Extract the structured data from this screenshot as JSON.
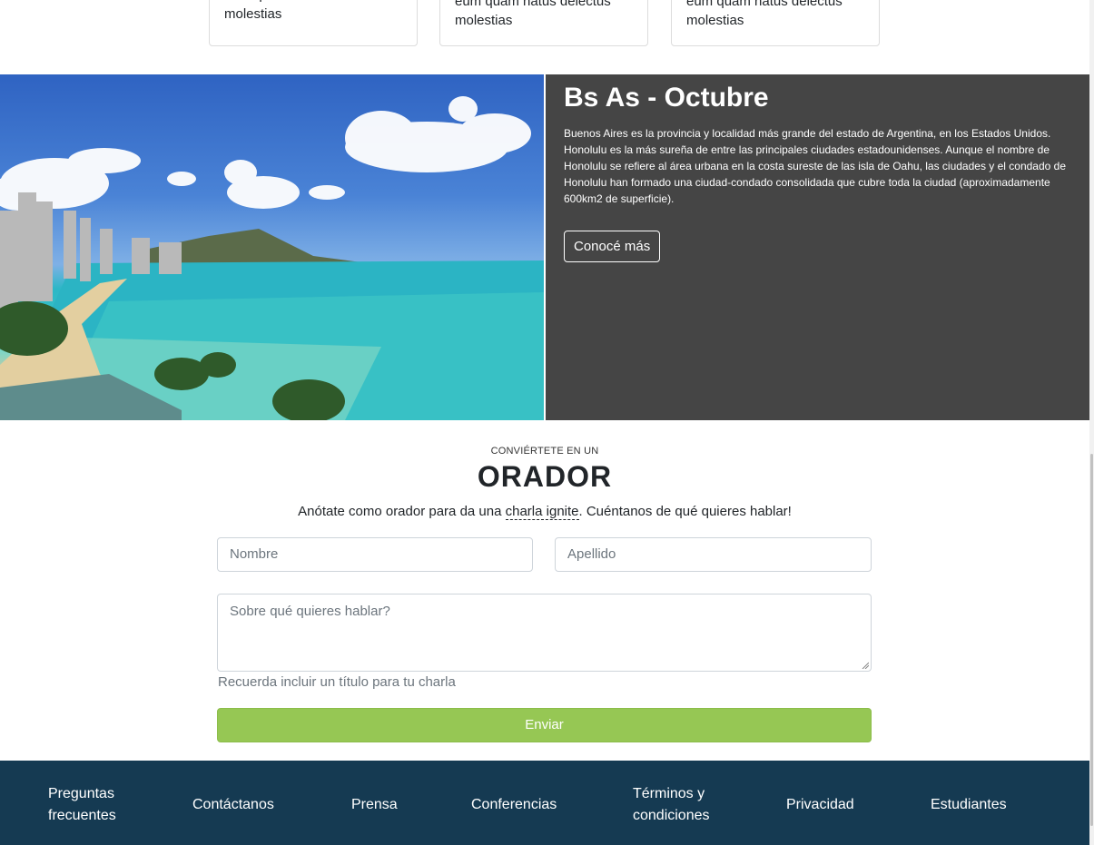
{
  "cards": [
    {
      "text": "eum quam natus delectus molestias"
    },
    {
      "text": "eum quam natus delectus molestias"
    },
    {
      "text": "eum quam natus delectus molestias"
    }
  ],
  "hero": {
    "title": "Bs As - Octubre",
    "description": "Buenos Aires es la provincia y localidad más grande del estado de Argentina, en los Estados Unidos. Honolulu es la más sureña de entre las principales ciudades estadounidenses. Aunque el nombre de Honolulu se refiere al área urbana en la costa sureste de las isla de Oahu, las ciudades y el condado de Honolulu han formado una ciudad-condado consolidada que cubre toda la ciudad (aproximadamente 600km2 de superficie).",
    "button_label": "Conocé más"
  },
  "orador": {
    "pre_title": "CONVIÉRTETE EN UN",
    "title": "ORADOR",
    "lead_before": "Anótate como orador para da una ",
    "lead_abbr": "charla ignite",
    "lead_after": ". Cuéntanos de qué quieres hablar!",
    "nombre_placeholder": "Nombre",
    "apellido_placeholder": "Apellido",
    "tema_placeholder": "Sobre qué quieres hablar?",
    "help_text": "Recuerda incluir un título para tu charla",
    "submit_label": "Enviar"
  },
  "footer": {
    "links": [
      {
        "line1": "Preguntas",
        "line2": "frecuentes"
      },
      {
        "line1": "Contáctanos",
        "line2": ""
      },
      {
        "line1": "Prensa",
        "line2": ""
      },
      {
        "line1": "Conferencias",
        "line2": ""
      },
      {
        "line1": "Términos y",
        "line2": "condiciones"
      },
      {
        "line1": "Privacidad",
        "line2": ""
      },
      {
        "line1": "Estudiantes",
        "line2": ""
      }
    ]
  },
  "colors": {
    "hero_panel": "#454545",
    "submit": "#96c754",
    "footer": "#153a52"
  }
}
